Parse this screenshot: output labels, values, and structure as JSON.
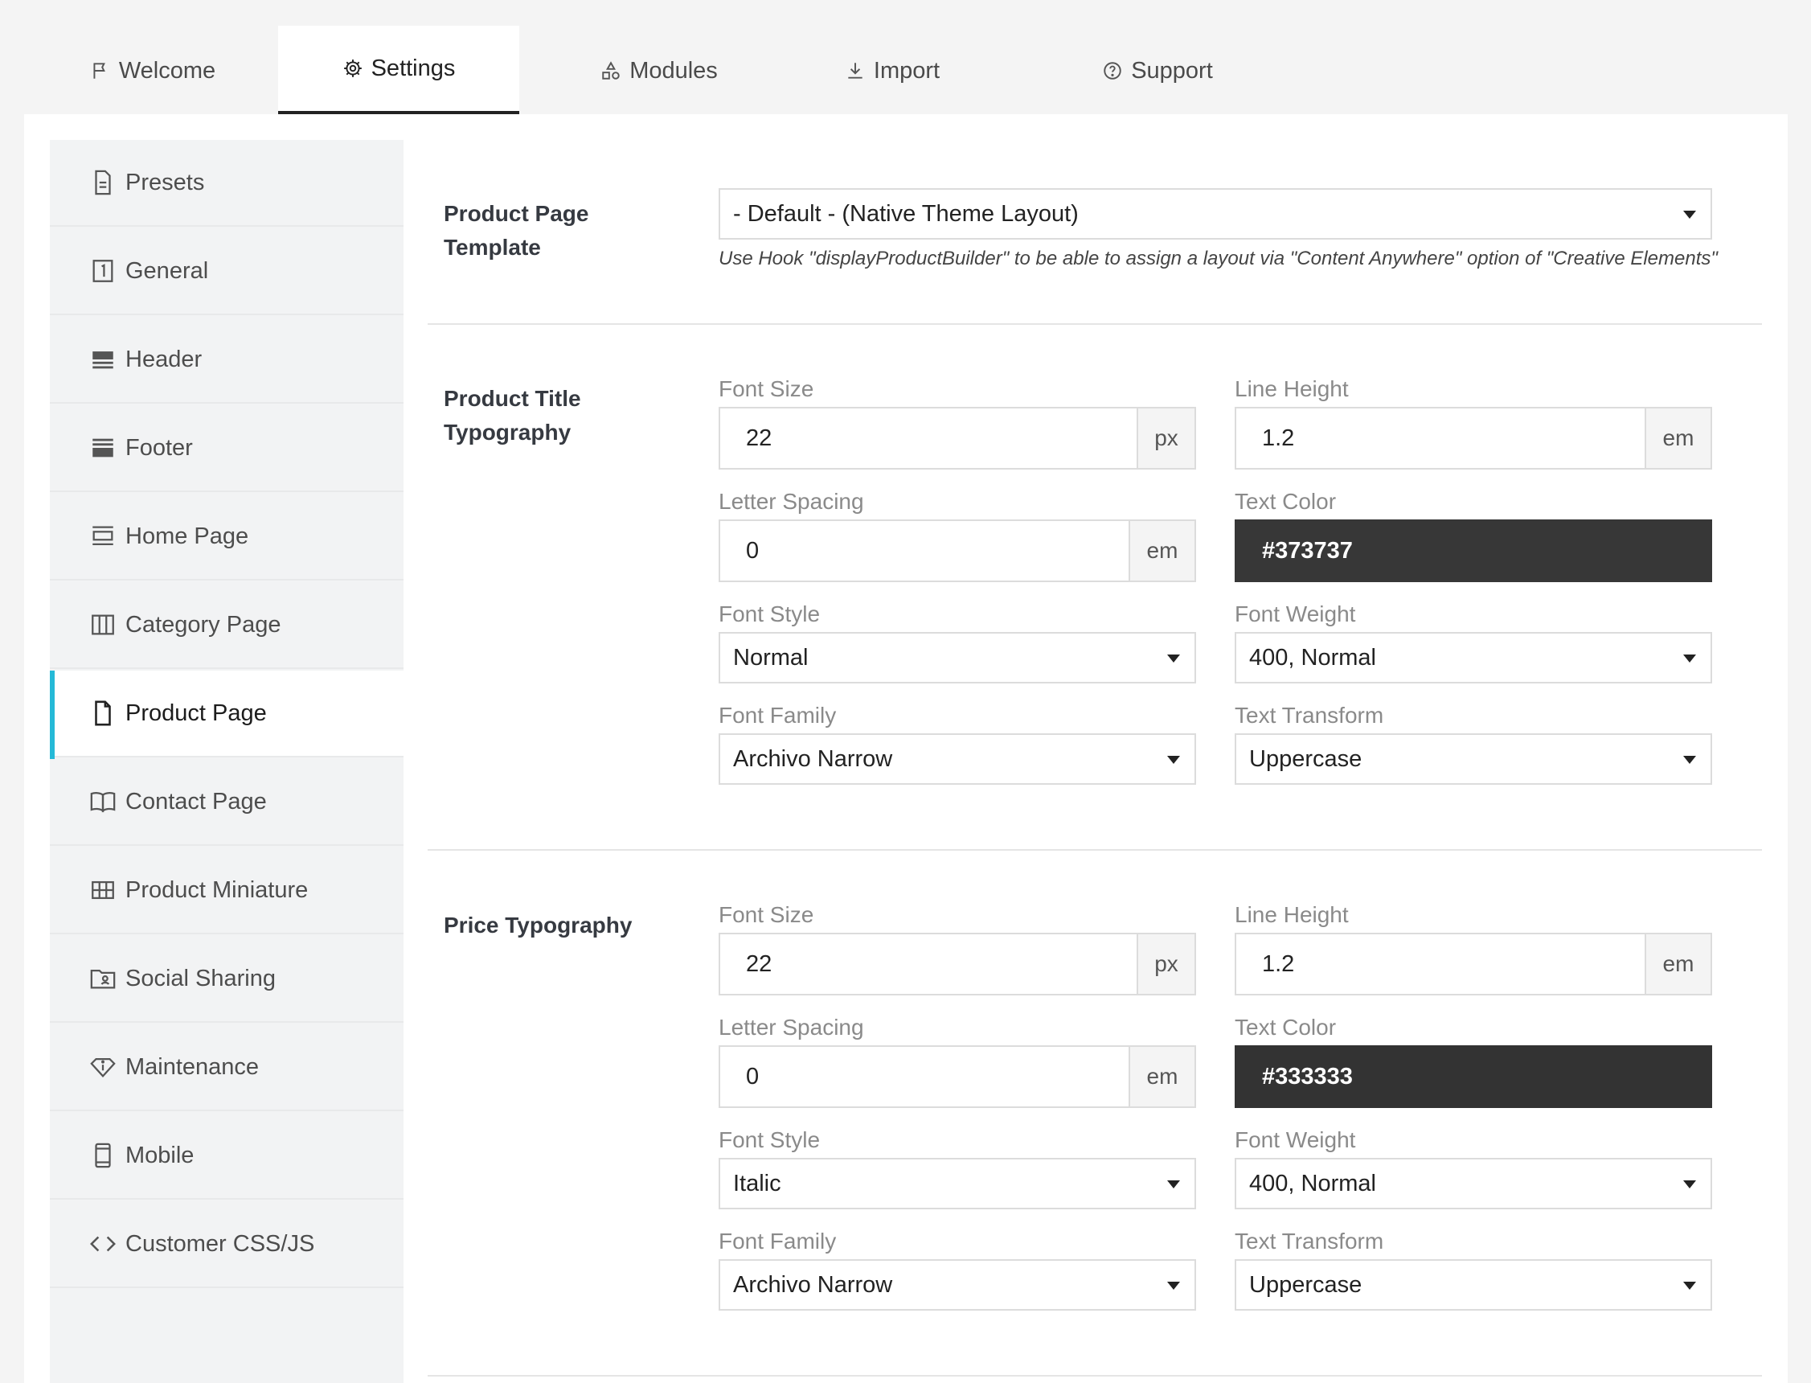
{
  "tabs": [
    {
      "label": "Welcome",
      "icon": "flag-icon"
    },
    {
      "label": "Settings",
      "icon": "gear-icon",
      "active": true
    },
    {
      "label": "Modules",
      "icon": "shapes-icon"
    },
    {
      "label": "Import",
      "icon": "download-icon"
    },
    {
      "label": "Support",
      "icon": "help-circle-icon"
    }
  ],
  "sidebar": {
    "items": [
      {
        "label": "Presets",
        "icon": "document-icon"
      },
      {
        "label": "General",
        "icon": "box-one-icon"
      },
      {
        "label": "Header",
        "icon": "header-icon"
      },
      {
        "label": "Footer",
        "icon": "footer-icon"
      },
      {
        "label": "Home Page",
        "icon": "home-layout-icon"
      },
      {
        "label": "Category Page",
        "icon": "columns-icon"
      },
      {
        "label": "Product Page",
        "icon": "page-icon",
        "active": true
      },
      {
        "label": "Contact Page",
        "icon": "book-icon"
      },
      {
        "label": "Product Miniature",
        "icon": "grid-icon"
      },
      {
        "label": "Social Sharing",
        "icon": "folder-user-icon"
      },
      {
        "label": "Maintenance",
        "icon": "diamond-info-icon"
      },
      {
        "label": "Mobile",
        "icon": "mobile-icon"
      },
      {
        "label": "Customer CSS/JS",
        "icon": "code-icon"
      }
    ],
    "accent_color": "#25b9d7"
  },
  "template": {
    "label_line1": "Product Page",
    "label_line2": "Template",
    "value": "- Default - (Native Theme Layout)",
    "hint": "Use Hook \"displayProductBuilder\" to be able to assign a layout via \"Content Anywhere\" option of \"Creative Elements\""
  },
  "labels": {
    "font_size": "Font Size",
    "line_height": "Line Height",
    "letter_spacing": "Letter Spacing",
    "text_color": "Text Color",
    "font_style": "Font Style",
    "font_weight": "Font Weight",
    "font_family": "Font Family",
    "text_transform": "Text Transform",
    "unit_px": "px",
    "unit_em": "em"
  },
  "title_typography": {
    "label_line1": "Product Title",
    "label_line2": "Typography",
    "font_size": "22",
    "line_height": "1.2",
    "letter_spacing": "0",
    "text_color": "#373737",
    "font_style": "Normal",
    "font_weight": "400, Normal",
    "font_family": "Archivo Narrow",
    "text_transform": "Uppercase"
  },
  "price_typography": {
    "label": "Price Typography",
    "font_size": "22",
    "line_height": "1.2",
    "letter_spacing": "0",
    "text_color": "#333333",
    "font_style": "Italic",
    "font_weight": "400, Normal",
    "font_family": "Archivo Narrow",
    "text_transform": "Uppercase"
  }
}
